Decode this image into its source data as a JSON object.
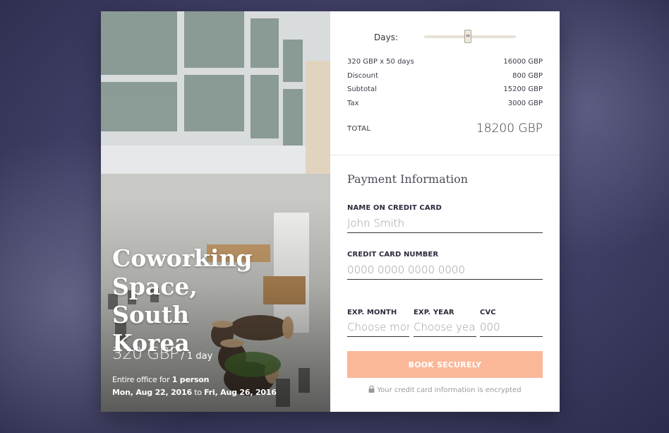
{
  "listing": {
    "title": "Coworking Space, South Korea",
    "price": "320 GBP",
    "per": "/ 1 day",
    "desc_prefix": "Entire office for ",
    "desc_people": "1 person",
    "date_from": "Mon, Aug 22, 2016",
    "date_to_word": "to",
    "date_to": "Fri, Aug 26, 2016"
  },
  "summary": {
    "days_label": "Days:",
    "days_value": 50,
    "lines": [
      {
        "label": "320 GBP x 50 days",
        "value": "16000 GBP"
      },
      {
        "label": "Discount",
        "value": "800 GBP"
      },
      {
        "label": "Subtotal",
        "value": "15200 GBP"
      },
      {
        "label": "Tax",
        "value": "3000 GBP"
      }
    ],
    "total_label": "TOTAL",
    "total_value": "18200 GBP"
  },
  "payment": {
    "heading": "Payment Information",
    "name_label": "NAME ON CREDIT CARD",
    "name_placeholder": "John Smith",
    "card_label": "CREDIT CARD NUMBER",
    "card_placeholder": "0000 0000 0000 0000",
    "exp_month_label": "EXP. MONTH",
    "exp_month_placeholder": "Choose month",
    "exp_year_label": "EXP. YEAR",
    "exp_year_placeholder": "Choose year",
    "cvc_label": "CVC",
    "cvc_placeholder": "000",
    "book_label": "BOOK SECURELY",
    "encrypt_note": "Your credit card information is encrypted"
  },
  "colors": {
    "accent": "#fbb899",
    "background": "#3f3f66"
  },
  "icons": {
    "lock": "lock-icon",
    "slider": "slider-thumb-icon"
  }
}
